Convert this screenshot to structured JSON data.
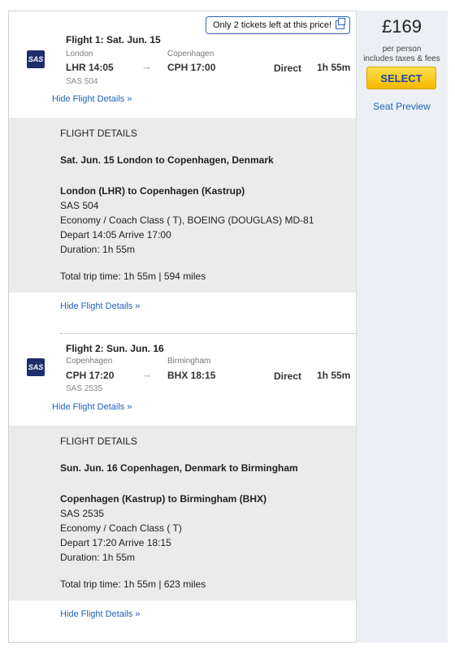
{
  "alert": {
    "text": "Only 2 tickets left at this price!",
    "icon": "external-link-icon"
  },
  "price": {
    "amount": "£169",
    "per_person": "per person",
    "includes": "includes taxes & fees",
    "select_label": "SELECT",
    "seat_preview": "Seat Preview"
  },
  "flight1": {
    "logo": "SAS",
    "title": "Flight 1:  Sat. Jun. 15",
    "from_city": "London",
    "from_code": "LHR  14:05",
    "to_city": "Copenhagen",
    "to_code": "CPH  17:00",
    "flight_no": "SAS 504",
    "stops": "Direct",
    "duration": "1h 55m",
    "hide_link": "Hide Flight Details »",
    "details": {
      "heading": "FLIGHT DETAILS",
      "route_date": "Sat. Jun. 15 London to Copenhagen, Denmark",
      "segment": "London (LHR) to Copenhagen (Kastrup)",
      "flight_no": "SAS 504",
      "cabin": "Economy / Coach Class ( T), BOEING (DOUGLAS) MD-81",
      "times": "Depart 14:05  Arrive 17:00",
      "duration": "Duration: 1h 55m",
      "total": "Total trip time: 1h 55m | 594 miles",
      "hide_link": "Hide Flight Details »"
    }
  },
  "flight2": {
    "logo": "SAS",
    "title": "Flight 2:  Sun. Jun. 16",
    "from_city": "Copenhagen",
    "from_code": "CPH  17:20",
    "to_city": "Birmingham",
    "to_code": "BHX  18:15",
    "flight_no": "SAS 2535",
    "stops": "Direct",
    "duration": "1h 55m",
    "hide_link": "Hide Flight Details »",
    "details": {
      "heading": "FLIGHT DETAILS",
      "route_date": "Sun. Jun. 16 Copenhagen, Denmark to Birmingham",
      "segment": "Copenhagen (Kastrup) to Birmingham (BHX)",
      "flight_no": "SAS 2535",
      "cabin": "Economy / Coach Class ( T)",
      "times": "Depart 17:20  Arrive 18:15",
      "duration": "Duration: 1h 55m",
      "total": "Total trip time: 1h 55m | 623 miles",
      "hide_link": "Hide Flight Details »"
    }
  }
}
